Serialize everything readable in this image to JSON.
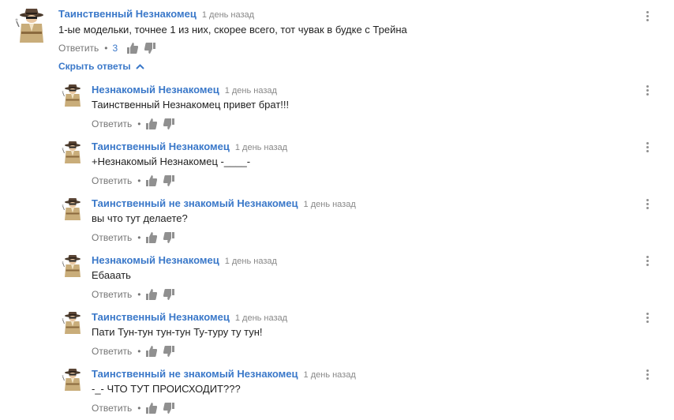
{
  "accent_color": "#3a78c9",
  "icons": {
    "avatar": "spy-detective-avatar",
    "like": "thumb-up-icon",
    "dislike": "thumb-down-icon",
    "menu": "more-vert-icon",
    "toggle": "chevron-up-icon"
  },
  "main_comment": {
    "author": "Таинственный Незнакомец",
    "time": "1 день назад",
    "text": "1-ые модельки, точнее 1 из них, скорее всего, тот чувак в будке с Трейна",
    "reply_label": "Ответить",
    "separator": "•",
    "like_count": "3"
  },
  "hide_replies_label": "Скрыть ответы",
  "replies": [
    {
      "author": "Незнакомый Незнакомец",
      "time": "1 день назад",
      "text": "Таинственный Незнакомец привет брат!!!",
      "reply_label": "Ответить",
      "separator": "•"
    },
    {
      "author": "Таинственный Незнакомец",
      "time": "1 день назад",
      "text": "+Незнакомый Незнакомец -____-",
      "reply_label": "Ответить",
      "separator": "•"
    },
    {
      "author": "Таинственный не знакомый Незнакомец",
      "time": "1 день назад",
      "text": "вы что  тут делаете?",
      "reply_label": "Ответить",
      "separator": "•"
    },
    {
      "author": "Незнакомый Незнакомец",
      "time": "1 день назад",
      "text": "Ебааать",
      "reply_label": "Ответить",
      "separator": "•"
    },
    {
      "author": "Таинственный Незнакомец",
      "time": "1 день назад",
      "text": "Пати Тун-тун тун-тун Ту-туру ту тун!",
      "reply_label": "Ответить",
      "separator": "•"
    },
    {
      "author": "Таинственный не знакомый Незнакомец",
      "time": "1 день назад",
      "text": "-_-  ЧТО ТУТ ПРОИСХОДИТ???",
      "reply_label": "Ответить",
      "separator": "•"
    }
  ]
}
